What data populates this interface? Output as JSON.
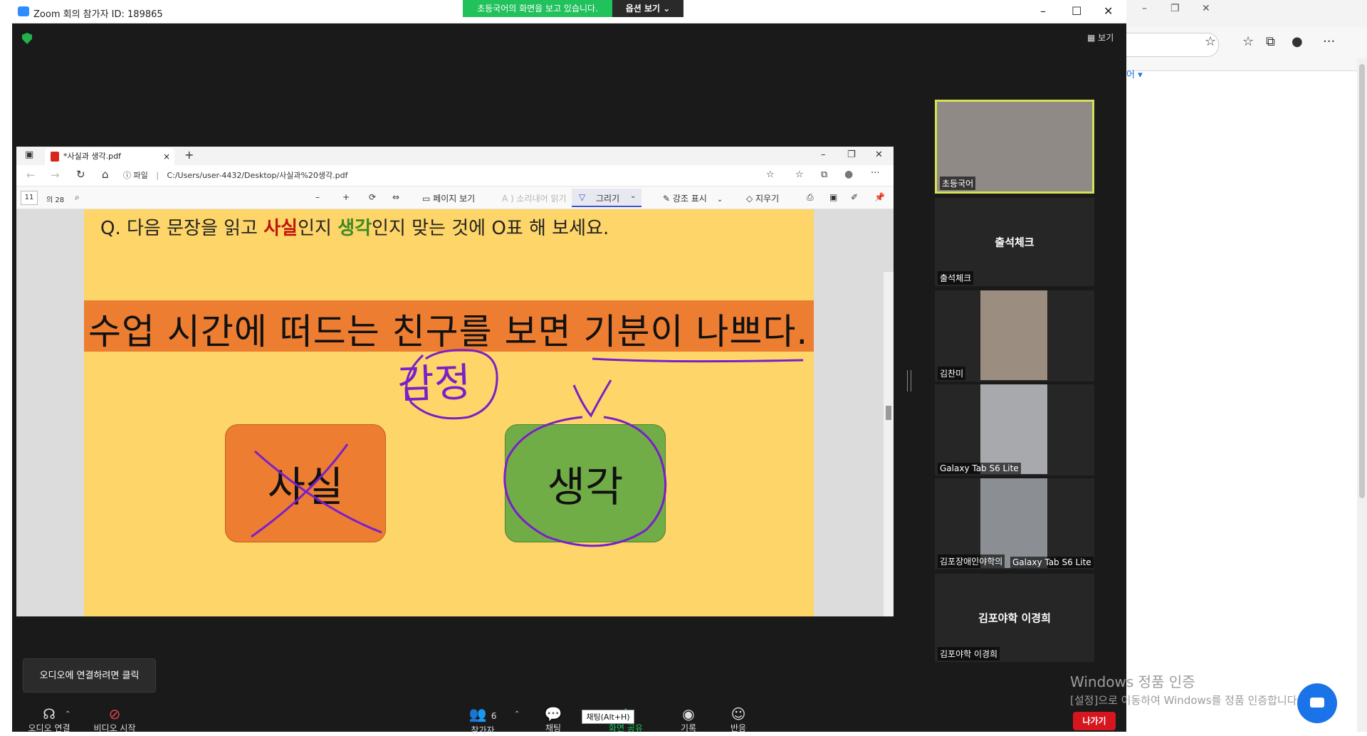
{
  "zoom": {
    "title": "Zoom 회의 참가자 ID: 189865",
    "share_banner": "초등국어의 화면을 보고 있습니다.",
    "options_label": "옵션 보기 ⌄",
    "view_label": "보기",
    "window_controls": [
      "–",
      "☐",
      "✕"
    ]
  },
  "pdf": {
    "tab_title": "*사실과 생각.pdf",
    "tab_close": "×",
    "new_tab": "+",
    "window_controls": [
      "–",
      "❐",
      "✕"
    ],
    "file_label": "파일",
    "address": "C:/Users/user-4432/Desktop/사실과%20생각.pdf",
    "page_current": "11",
    "page_total": "의 28",
    "toolbar": {
      "page_view": "페이지 보기",
      "read_aloud": "소리내어 읽기",
      "draw": "그리기",
      "highlight": "강조 표시",
      "erase": "지우기"
    }
  },
  "slide": {
    "question_prefix": "Q. 다음 문장을 읽고 ",
    "question_fact": "사실",
    "question_mid": "인지 ",
    "question_opinion": "생각",
    "question_suffix": "인지 맞는 것에 O표 해 보세요.",
    "sentence": "수업 시간에 떠드는 친구를 보면 기분이 나쁘다.",
    "box_fact": "사실",
    "box_opinion": "생각",
    "handwritten_note": "감정",
    "colors": {
      "background": "#fdd568",
      "band": "#ed7d31",
      "fact_box": "#ed7d31",
      "opinion_box": "#70ad47",
      "ink": "#7b1fc9"
    }
  },
  "gallery": [
    {
      "name": "초등국어",
      "type": "video",
      "active_speaker": true
    },
    {
      "name": "출석체크",
      "center_name": "출석체크",
      "type": "name-only"
    },
    {
      "name": "김찬미",
      "type": "video"
    },
    {
      "name": "Galaxy Tab S6 Lite",
      "type": "video"
    },
    {
      "name": "김포장애인야학의",
      "name_extra": "Galaxy Tab S6 Lite",
      "type": "video"
    },
    {
      "name": "김포야학 이경희",
      "center_name": "김포야학 이경희",
      "type": "name-only"
    }
  ],
  "controls": {
    "audio_tooltip": "오디오에 연결하려면 클릭",
    "audio": "오디오 연결",
    "video": "비디오 시작",
    "participants": "참가자",
    "participants_count": "6",
    "chat": "채팅",
    "chat_tooltip": "채팅(Alt+H)",
    "share": "화면 공유",
    "record": "기록",
    "reactions": "반응",
    "leave": "나가기"
  },
  "watermark": {
    "title": "Windows 정품 인증",
    "subtitle": "[설정]으로 이동하여 Windows를 정품 인증합니다."
  },
  "bg_browser": {
    "link_fragment": "어 ▾"
  }
}
